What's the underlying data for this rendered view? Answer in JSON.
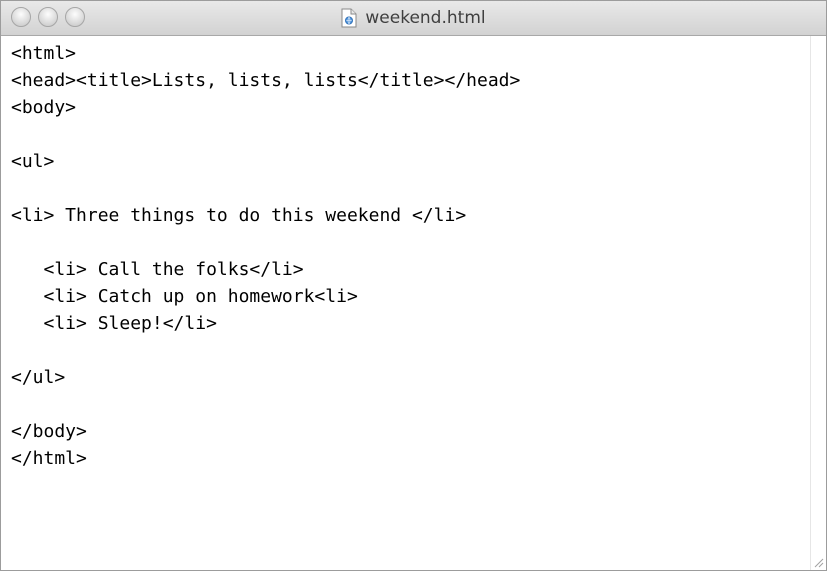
{
  "window": {
    "title": "weekend.html",
    "file_icon": "html-document-icon"
  },
  "editor": {
    "lines": [
      "<html>",
      "<head><title>Lists, lists, lists</title></head>",
      "<body>",
      "",
      "<ul>",
      "",
      "<li> Three things to do this weekend </li>",
      "",
      "   <li> Call the folks</li>",
      "   <li> Catch up on homework<li>",
      "   <li> Sleep!</li>",
      "",
      "</ul>",
      "",
      "</body>",
      "</html>"
    ]
  },
  "colors": {
    "titlebar_top": "#e9e9e9",
    "titlebar_bottom": "#d2d2d2",
    "text": "#000000"
  }
}
